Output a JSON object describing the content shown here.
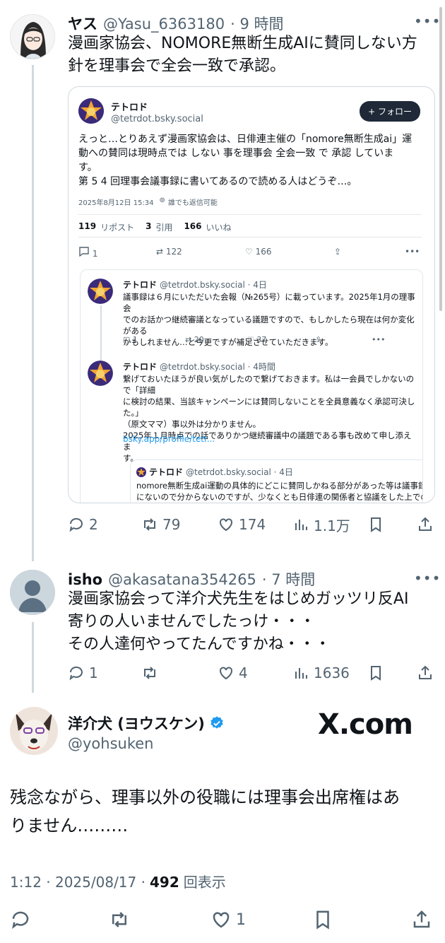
{
  "tweet1": {
    "name": "ヤス",
    "handle": "@Yasu_6363180",
    "time": "· 9 時間",
    "text_line1": "漫画家協会、NOMORE無断生成AIに賛同しない方",
    "text_line2": "針を理事会で全会一致で承認。",
    "card": {
      "name": "テトロド",
      "handle": "@tetrdot.bsky.social",
      "follow_label": "+ フォロー",
      "text_l1": "えっと…とりあえず漫画家協会は、日俳連主催の「nomore無断生成ai」運",
      "text_l2": "動への賛同は現時点では しない 事を理事会 全会一致 で 承認 していま",
      "text_l3": "す。",
      "text_l4": "第 5 4 回理事会議事録に書いてあるので読める人はどうぞ…。",
      "date": "2025年8月12日 15:34",
      "reply_setting": "誰でも返信可能",
      "reposts_num": "119",
      "reposts_label": "リポスト",
      "quotes_num": "3",
      "quotes_label": "引用",
      "likes_num": "166",
      "likes_label": "いいね",
      "act_reply": "1",
      "act_repost": "122",
      "act_like": "166",
      "reply1": {
        "name": "テトロド",
        "meta": "@tetrdot.bsky.social · 4日",
        "l1": "議事録は６月にいただいた会報（№265号）に載っています。2025年1月の理事会",
        "l2": "でのお話かつ継続審議となっている議題ですので、もしかしたら現在は何か変化がある",
        "l3": "かもしれません…と今更ですが補足させていただきます。",
        "act_reply": "1",
        "act_repost": "20",
        "act_like": "37"
      },
      "reply2": {
        "name": "テトロド",
        "meta": "@tetrdot.bsky.social · 4時間",
        "l1": "繋げておいたほうが良い気がしたので繋げておきます。私は一会員でしかないので「詳細",
        "l2": "に検討の結果、当該キャンペーンには賛同しないことを全員意義なく承認可決した。」",
        "l3": "（原文ママ）事以外は分かりません。",
        "l4": "2025年１月時点での話でありかつ継続審議中の議題である事も改めて申し添えま",
        "l5": "す。",
        "link": "bsky.app/profile/tetr..."
      },
      "quote": {
        "name": "テトロド",
        "meta": "@tetrdot.bsky.social · 4日",
        "l1": "nomore無断生成ai運動の具体的にどこに賛同しかねる部分があった等は議事録",
        "l2": "にないので分からないのですが、少なくとも日俳連の関係者と協議をした上での「賛"
      }
    },
    "replies": "2",
    "reposts": "79",
    "likes": "174",
    "views": "1.1万"
  },
  "tweet2": {
    "name": "isho",
    "handle": "@akasatana354265",
    "time": "· 7 時間",
    "l1": "漫画家協会って洋介犬先生をはじめガッツリ反AI",
    "l2": "寄りの人いませんでしたっけ・・・",
    "l3": "その人達何やってたんですかね・・・",
    "replies": "1",
    "reposts": "",
    "likes": "4",
    "views": "1636"
  },
  "tweet3": {
    "name": "洋介犬 (ヨウスケン)",
    "handle": "@yohsuken",
    "xcom": "X.com",
    "l1": "残念ながら、理事以外の役職には理事会出席権はあ",
    "l2": "りません………",
    "time": "1:12 · 2025/08/17 ·",
    "views_num": "492",
    "views_label": "回表示",
    "likes": "1"
  },
  "colors": {
    "accent": "#1d9bf0",
    "muted": "#536471",
    "border": "#cfd9de"
  }
}
